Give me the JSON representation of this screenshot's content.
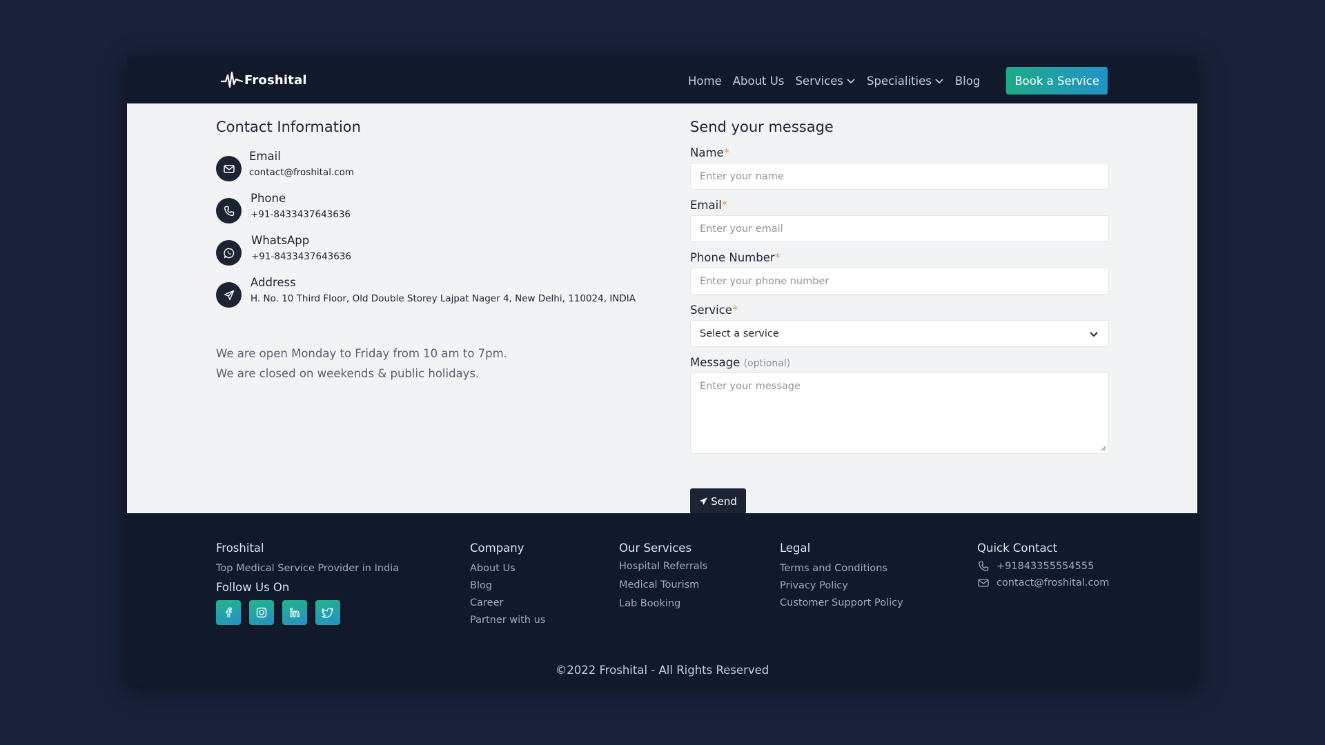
{
  "brand": {
    "name": "Froshital"
  },
  "nav": {
    "items": [
      "Home",
      "About Us",
      "Services",
      "Specialities",
      "Blog"
    ],
    "cta": "Book a Service"
  },
  "contact": {
    "title": "Contact Information",
    "items": [
      {
        "label": "Email",
        "value": "contact@froshital.com",
        "icon": "mail-icon"
      },
      {
        "label": "Phone",
        "value": "+91-8433437643636",
        "icon": "phone-icon"
      },
      {
        "label": "WhatsApp",
        "value": "+91-8433437643636",
        "icon": "whatsapp-icon"
      },
      {
        "label": "Address",
        "value": "H. No. 10 Third Floor, Old Double Storey Lajpat Nager 4, New Delhi, 110024, INDIA",
        "icon": "send-icon"
      }
    ],
    "hours": [
      "We are open Monday to Friday from 10 am to 7pm.",
      "We are closed on weekends & public holidays."
    ]
  },
  "form": {
    "title": "Send your message",
    "name": {
      "label": "Name",
      "placeholder": "Enter your name"
    },
    "email": {
      "label": "Email",
      "placeholder": "Enter your email"
    },
    "phone": {
      "label": "Phone Number",
      "placeholder": "Enter your phone number"
    },
    "service": {
      "label": "Service",
      "value": "Select a service"
    },
    "message": {
      "label": "Message",
      "optional": "(optional)",
      "placeholder": "Enter your message"
    },
    "required_mark": "*",
    "send": "Send"
  },
  "footer": {
    "brand": "Froshital",
    "tagline": "Top Medical Service Provider in India",
    "follow": "Follow Us On",
    "socials": [
      "facebook-icon",
      "instagram-icon",
      "linkedin-icon",
      "twitter-icon"
    ],
    "company": {
      "title": "Company",
      "links": [
        "About Us",
        "Blog",
        "Career",
        "Partner with us"
      ]
    },
    "services": {
      "title": "Our Services",
      "links": [
        "Hospital Referrals",
        "Medical Tourism",
        "Lab Booking"
      ]
    },
    "legal": {
      "title": "Legal",
      "links": [
        "Terms and Conditions",
        "Privacy Policy",
        "Customer Support Policy"
      ]
    },
    "quick": {
      "title": "Quick Contact",
      "phone": "+91843355554555",
      "email": "contact@froshital.com"
    },
    "copyright": "©2022 Froshital - All Rights Reserved"
  },
  "colors": {
    "accent_start": "#1eaa86",
    "accent_end": "#2093c8",
    "dark": "#111a2b",
    "required": "#e0a056"
  }
}
